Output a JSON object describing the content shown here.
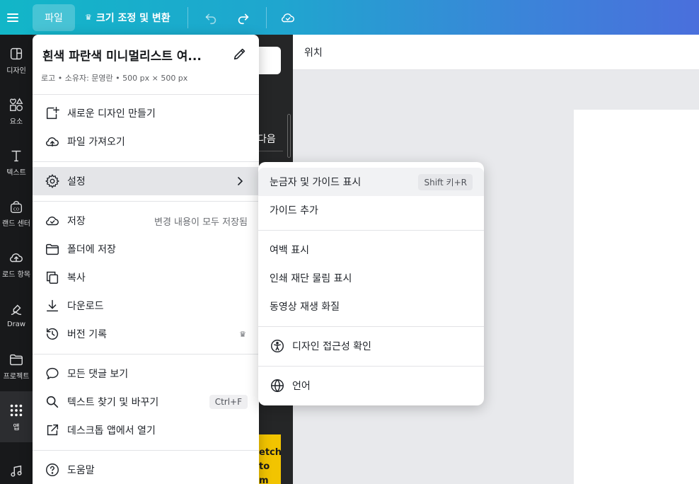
{
  "topbar": {
    "file_label": "파일",
    "resize_label": "크기 조정 및 변환",
    "crown_icon": "crown-icon"
  },
  "rail": {
    "items": [
      {
        "label": "디자인",
        "icon": "design-icon"
      },
      {
        "label": "요소",
        "icon": "elements-icon"
      },
      {
        "label": "텍스트",
        "icon": "text-icon"
      },
      {
        "label": "랜드 센터",
        "icon": "brand-icon"
      },
      {
        "label": "로드 항목",
        "icon": "upload-icon"
      },
      {
        "label": "Draw",
        "icon": "draw-icon"
      },
      {
        "label": "프로젝트",
        "icon": "folder-icon"
      },
      {
        "label": "앱",
        "icon": "apps-icon"
      }
    ]
  },
  "sidepanel": {
    "next_label": "다음",
    "thumb_text": "etch to m"
  },
  "canvas": {
    "header_label": "위치"
  },
  "menu": {
    "title": "흰색 파란색 미니멀리스트 여...",
    "subtitle": "로고 • 소유자: 문영란 • 500 px × 500 px",
    "items": {
      "new_design": "새로운 디자인 만들기",
      "import_file": "파일 가져오기",
      "settings": "설정",
      "save": "저장",
      "save_status": "변경 내용이 모두 저장됨",
      "save_to_folder": "폴더에 저장",
      "copy": "복사",
      "download": "다운로드",
      "version_history": "버전 기록",
      "view_comments": "모든 댓글 보기",
      "find_replace": "텍스트 찾기 및 바꾸기",
      "find_replace_shortcut": "Ctrl+F",
      "open_desktop": "데스크톱 앱에서 열기",
      "help": "도움말"
    }
  },
  "submenu": {
    "show_rulers": "눈금자 및 가이드 표시",
    "show_rulers_shortcut": "Shift 키+R",
    "add_guide": "가이드 추가",
    "show_margins": "여백 표시",
    "show_print_bleed": "인쇄 재단 물림 표시",
    "video_quality": "동영상 재생 화질",
    "accessibility": "디자인 접근성 확인",
    "language": "언어"
  }
}
